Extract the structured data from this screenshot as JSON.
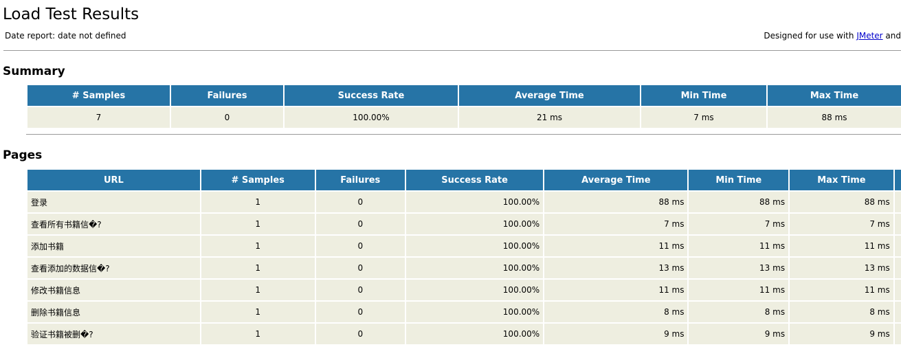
{
  "page": {
    "title": "Load Test Results",
    "date_report": "Date report: date not defined",
    "designed_prefix": "Designed for use with ",
    "designed_link": "JMeter",
    "designed_suffix": " and"
  },
  "summary": {
    "heading": "Summary",
    "headers": [
      "# Samples",
      "Failures",
      "Success Rate",
      "Average Time",
      "Min Time",
      "Max Time"
    ],
    "row": [
      "7",
      "0",
      "100.00%",
      "21 ms",
      "7 ms",
      "88 ms"
    ]
  },
  "pages": {
    "heading": "Pages",
    "headers": [
      "URL",
      "# Samples",
      "Failures",
      "Success Rate",
      "Average Time",
      "Min Time",
      "Max Time",
      ""
    ],
    "rows": [
      [
        "登录",
        "1",
        "0",
        "100.00%",
        "88 ms",
        "88 ms",
        "88 ms"
      ],
      [
        "查看所有书籍信�?",
        "1",
        "0",
        "100.00%",
        "7 ms",
        "7 ms",
        "7 ms"
      ],
      [
        "添加书籍",
        "1",
        "0",
        "100.00%",
        "11 ms",
        "11 ms",
        "11 ms"
      ],
      [
        "查看添加的数据信�?",
        "1",
        "0",
        "100.00%",
        "13 ms",
        "13 ms",
        "13 ms"
      ],
      [
        "修改书籍信息",
        "1",
        "0",
        "100.00%",
        "11 ms",
        "11 ms",
        "11 ms"
      ],
      [
        "删除书籍信息",
        "1",
        "0",
        "100.00%",
        "8 ms",
        "8 ms",
        "8 ms"
      ],
      [
        "验证书籍被删�?",
        "1",
        "0",
        "100.00%",
        "9 ms",
        "9 ms",
        "9 ms"
      ]
    ]
  },
  "colors": {
    "header_bg": "#2674a6",
    "cell_bg": "#eeeee0",
    "link": "#0000cc"
  }
}
